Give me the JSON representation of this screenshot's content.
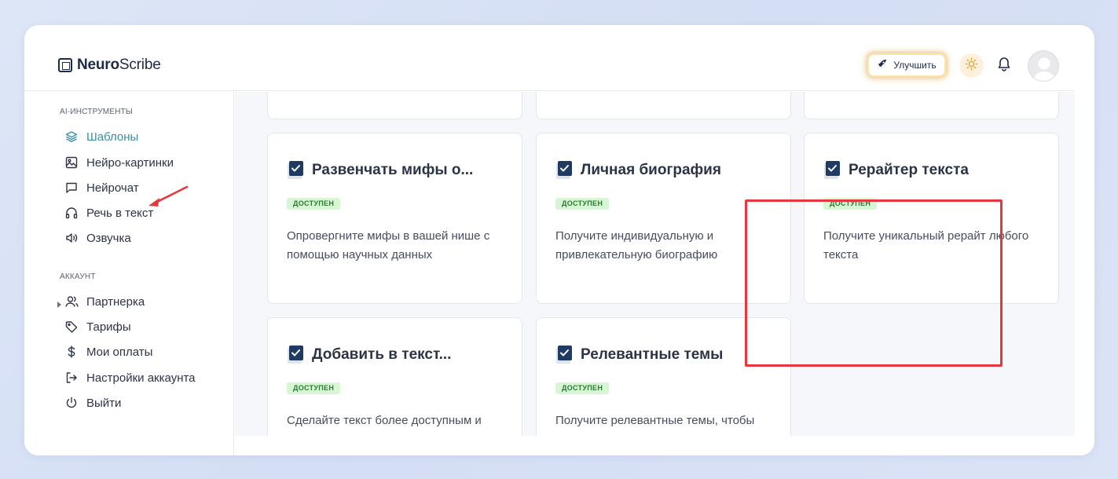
{
  "brand": {
    "name_bold": "Neuro",
    "name_rest": "Scribe"
  },
  "header": {
    "upgrade_label": "Улучшить"
  },
  "sidebar": {
    "section_tools": "AI-ИНСТРУМЕНТЫ",
    "tools": [
      {
        "label": "Шаблоны",
        "icon": "layers-icon",
        "active": true
      },
      {
        "label": "Нейро-картинки",
        "icon": "image-icon"
      },
      {
        "label": "Нейрочат",
        "icon": "chat-icon"
      },
      {
        "label": "Речь в текст",
        "icon": "headphones-icon"
      },
      {
        "label": "Озвучка",
        "icon": "speaker-icon"
      }
    ],
    "section_account": "АККАУНТ",
    "account": [
      {
        "label": "Партнерка",
        "icon": "users-icon"
      },
      {
        "label": "Тарифы",
        "icon": "tag-icon"
      },
      {
        "label": "Мои оплаты",
        "icon": "dollar-icon"
      },
      {
        "label": "Настройки аккаунта",
        "icon": "logout-arrow-icon"
      },
      {
        "label": "Выйти",
        "icon": "power-icon"
      }
    ]
  },
  "cards": [
    {
      "title": "Развенчать мифы о...",
      "badge": "ДОСТУПЕН",
      "desc": "Опровергните мифы в вашей нише с помощью научных данных"
    },
    {
      "title": "Личная биография",
      "badge": "ДОСТУПЕН",
      "desc": "Получите индивидуальную и привлекательную биографию"
    },
    {
      "title": "Рерайтер текста",
      "badge": "ДОСТУПЕН",
      "desc": "Получите уникальный рерайт любого текста"
    },
    {
      "title": "Добавить в текст...",
      "badge": "ДОСТУПЕН",
      "desc": "Сделайте текст более доступным и"
    },
    {
      "title": "Релевантные темы",
      "badge": "ДОСТУПЕН",
      "desc": "Получите релевантные темы, чтобы"
    }
  ],
  "colors": {
    "accent": "#3a8fa3",
    "highlight": "#e6373f",
    "badge_bg": "#d6f6d4",
    "badge_text": "#2c7a34"
  }
}
